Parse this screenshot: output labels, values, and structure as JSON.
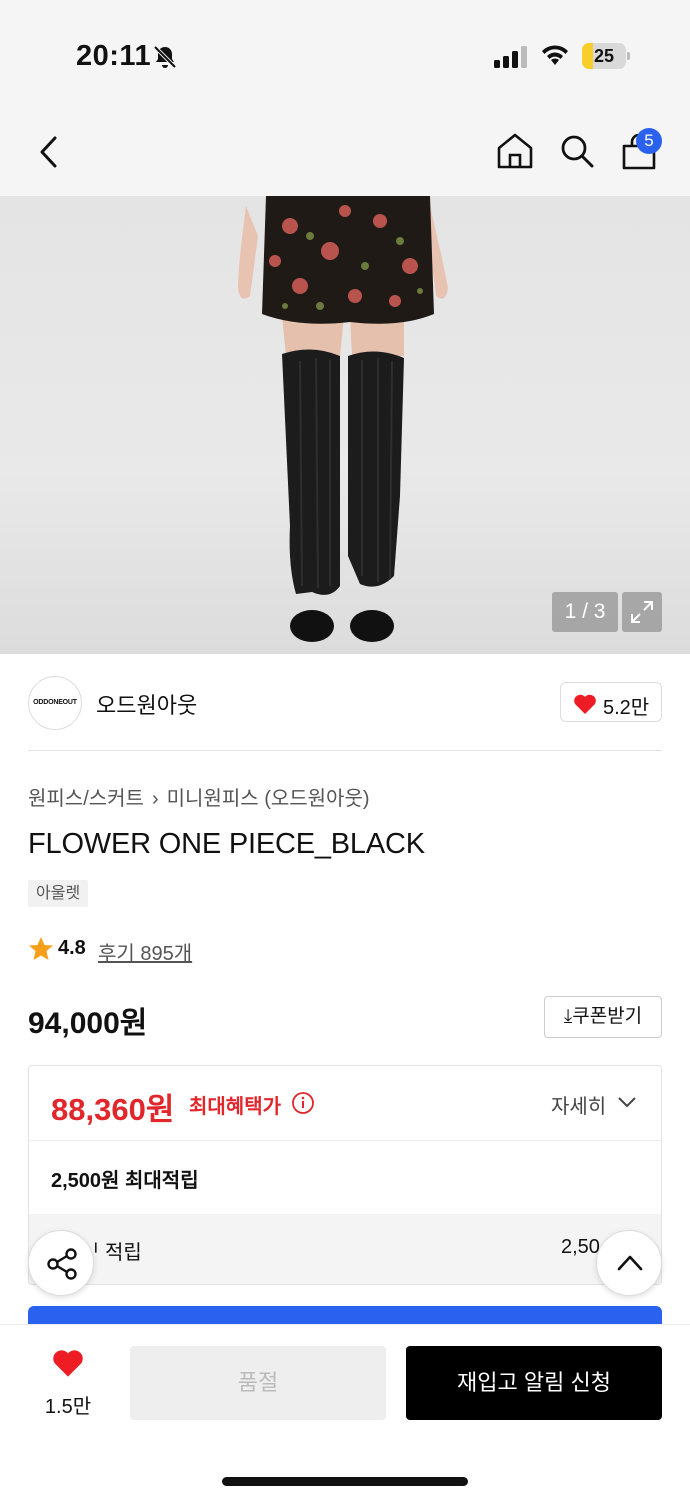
{
  "status_bar": {
    "time": "20:11",
    "battery": "25",
    "battery_level": 0.25
  },
  "nav": {
    "cart_count": "5",
    "icons": [
      "back-icon",
      "home-icon",
      "search-icon",
      "cart-icon"
    ]
  },
  "gallery": {
    "counter": "1 / 3"
  },
  "brand": {
    "logo_text": "ODDONEOUT",
    "name": "오드원아웃",
    "likes": "5.2만"
  },
  "breadcrumb": {
    "level1": "원피스/스커트",
    "level2": "미니원피스 (오드원아웃)"
  },
  "product": {
    "title": "FLOWER ONE PIECE_BLACK",
    "tag": "아울렛",
    "rating": "4.8",
    "review_text": "후기 895개",
    "price": "94,000원",
    "coupon_label": "쿠폰받기"
  },
  "benefit": {
    "best_price": "88,360원",
    "best_label": "최대혜택가",
    "detail_label": "자세히",
    "max_points": "2,500원 최대적립",
    "point_label": "적립",
    "point_value": "2,50"
  },
  "bottom_bar": {
    "wish_count": "1.5만",
    "soldout_label": "품절",
    "restock_label": "재입고 알림 신청"
  },
  "colors": {
    "accent_blue": "#2a61ee",
    "price_red": "#e1262c",
    "heart_red": "#ee1c25",
    "star": "#f6a01a"
  }
}
